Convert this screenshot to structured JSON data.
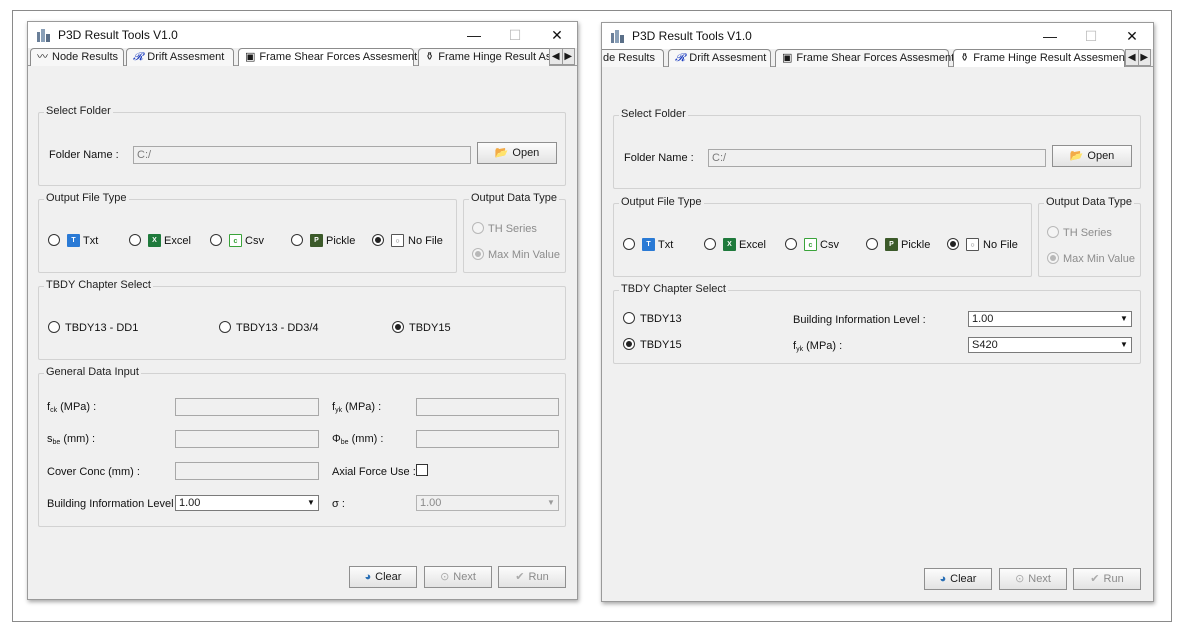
{
  "left": {
    "title": "P3D Result Tools V1.0",
    "window_controls": {
      "minimize": "—",
      "maximize": "☐",
      "close": "✕"
    },
    "tabs": [
      {
        "label": "Node Results",
        "icon": "waveform-icon"
      },
      {
        "label": "Drift Assesment",
        "icon": "drift-icon"
      },
      {
        "label": "Frame Shear Forces Assesment",
        "icon": "frame-icon"
      },
      {
        "label": "Frame Hinge Result Asse",
        "icon": "hinge-icon"
      }
    ],
    "tab_scroll": {
      "left": "◀",
      "right": "▶"
    },
    "select_folder": {
      "title": "Select Folder",
      "folder_label": "Folder Name :",
      "folder_value": "C:/",
      "open_label": "Open"
    },
    "output_file_type": {
      "title": "Output File Type",
      "options": [
        {
          "label": "Txt",
          "checked": false
        },
        {
          "label": "Excel",
          "checked": false
        },
        {
          "label": "Csv",
          "checked": false
        },
        {
          "label": "Pickle",
          "checked": false
        },
        {
          "label": "No File",
          "checked": true
        }
      ]
    },
    "output_data_type": {
      "title": "Output Data Type",
      "options": [
        {
          "label": "TH Series",
          "checked": false
        },
        {
          "label": "Max  Min Value",
          "checked": true
        }
      ]
    },
    "tbdy": {
      "title": "TBDY Chapter Select",
      "options": [
        {
          "label": "TBDY13 - DD1",
          "checked": false
        },
        {
          "label": "TBDY13 - DD3/4",
          "checked": false
        },
        {
          "label": "TBDY15",
          "checked": true
        }
      ]
    },
    "general": {
      "title": "General Data Input",
      "fck_label": "f",
      "fck_sub": "ck",
      "fck_unit": " (MPa) :",
      "fyk_label": "f",
      "fyk_sub": "yk",
      "fyk_unit": " (MPa) :",
      "sbe_label": "s",
      "sbe_sub": "be",
      "sbe_unit": " (mm) :",
      "phibe_label": "Φ",
      "phibe_sub": "be",
      "phibe_unit": " (mm) :",
      "cover_label": "Cover Conc (mm) :",
      "axial_label": "Axial Force Use :",
      "bil_label": "Building Information Level :",
      "bil_value": "1.00",
      "sigma_label": "σ :",
      "sigma_value": "1.00"
    },
    "buttons": {
      "clear": "Clear",
      "next": "Next",
      "run": "Run"
    }
  },
  "right": {
    "title": "P3D Result Tools V1.0",
    "window_controls": {
      "minimize": "—",
      "maximize": "☐",
      "close": "✕"
    },
    "tabs": [
      {
        "label": "de Results",
        "icon": "waveform-icon"
      },
      {
        "label": "Drift Assesment",
        "icon": "drift-icon"
      },
      {
        "label": "Frame Shear Forces Assesment",
        "icon": "frame-icon"
      },
      {
        "label": "Frame Hinge Result Assesment",
        "icon": "hinge-icon"
      }
    ],
    "tab_scroll": {
      "left": "◀",
      "right": "▶"
    },
    "select_folder": {
      "title": "Select Folder",
      "folder_label": "Folder Name :",
      "folder_value": "C:/",
      "open_label": "Open"
    },
    "output_file_type": {
      "title": "Output File Type",
      "options": [
        {
          "label": "Txt",
          "checked": false
        },
        {
          "label": "Excel",
          "checked": false
        },
        {
          "label": "Csv",
          "checked": false
        },
        {
          "label": "Pickle",
          "checked": false
        },
        {
          "label": "No File",
          "checked": true
        }
      ]
    },
    "output_data_type": {
      "title": "Output Data Type",
      "options": [
        {
          "label": "TH Series",
          "checked": false
        },
        {
          "label": "Max  Min Value",
          "checked": true
        }
      ]
    },
    "tbdy": {
      "title": "TBDY Chapter Select",
      "options": [
        {
          "label": "TBDY13",
          "checked": false
        },
        {
          "label": "TBDY15",
          "checked": true
        }
      ],
      "bil_label": "Building Information Level :",
      "bil_value": "1.00",
      "fyk_label": "f",
      "fyk_sub": "yk",
      "fyk_unit": " (MPa) :",
      "fyk_value": "S420"
    },
    "buttons": {
      "clear": "Clear",
      "next": "Next",
      "run": "Run"
    }
  },
  "colors": {
    "window_bg": "#f0f0f0",
    "txt_icon": "#2a7ad5",
    "excel_icon": "#1f7a3c",
    "csv_icon": "#3aa33a",
    "pickle_icon": "#3c5a2a",
    "open_icon": "#e8b420"
  }
}
